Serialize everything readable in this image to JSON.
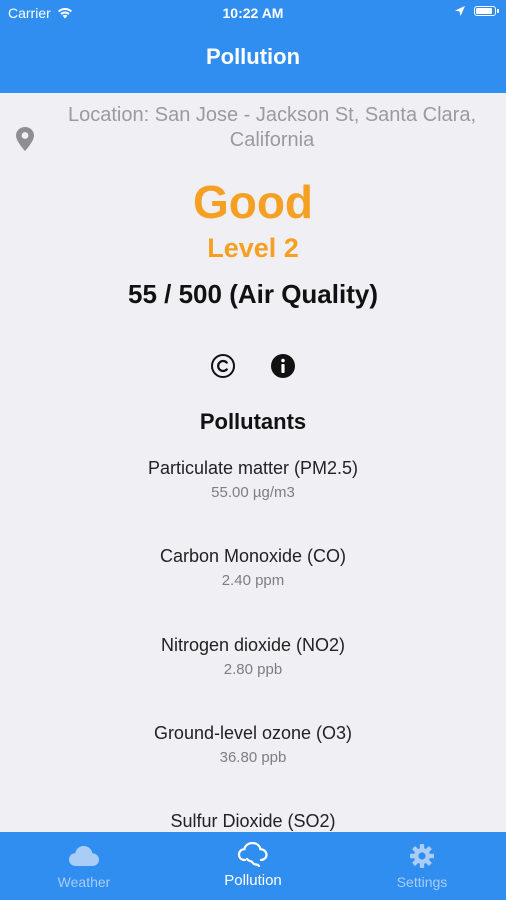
{
  "status_bar": {
    "carrier": "Carrier",
    "time": "10:22 AM"
  },
  "nav": {
    "title": "Pollution"
  },
  "location": {
    "text": "Location: San Jose - Jackson St, Santa Clara, California"
  },
  "aqi": {
    "label": "Good",
    "level": "Level 2",
    "value_text": "55 / 500 (Air Quality)"
  },
  "pollutants": {
    "title": "Pollutants",
    "items": [
      {
        "name": "Particulate matter (PM2.5)",
        "value": "55.00 µg/m3"
      },
      {
        "name": "Carbon Monoxide (CO)",
        "value": "2.40 ppm"
      },
      {
        "name": "Nitrogen dioxide (NO2)",
        "value": "2.80 ppb"
      },
      {
        "name": "Ground-level ozone (O3)",
        "value": "36.80 ppb"
      },
      {
        "name": "Sulfur Dioxide (SO2)",
        "value": ""
      }
    ]
  },
  "tabs": [
    {
      "label": "Weather",
      "icon": "cloud-icon"
    },
    {
      "label": "Pollution",
      "icon": "pollution-cloud-icon"
    },
    {
      "label": "Settings",
      "icon": "gear-icon"
    }
  ],
  "colors": {
    "accent": "#2f8ef0",
    "aqi_status": "#f5a022",
    "background": "#efeff4"
  }
}
